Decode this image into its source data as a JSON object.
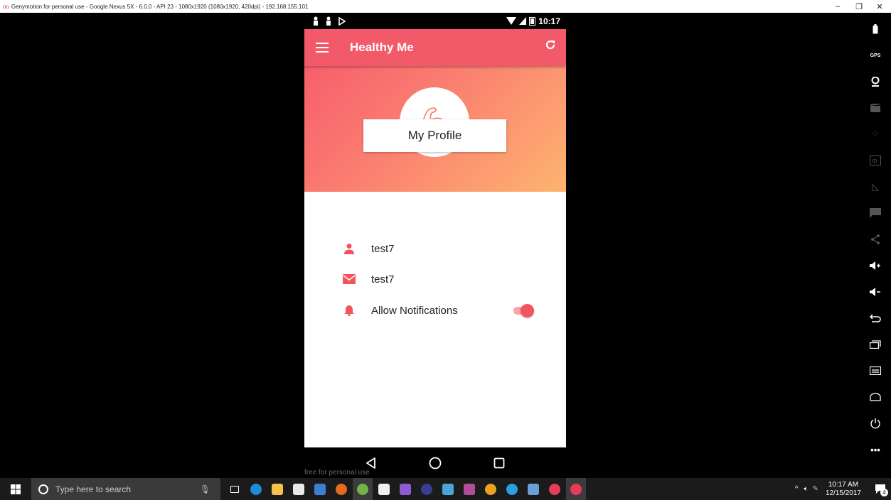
{
  "window": {
    "title": "Genymotion for personal use - Google Nexus 5X - 6.0.0 - API 23 - 1080x1920 (1080x1920, 420dpi) - 192.168.155.101",
    "minimize": "–",
    "restore": "❐",
    "close": "✕"
  },
  "device": {
    "statusbar": {
      "time": "10:17"
    },
    "appbar": {
      "title": "Healthy Me"
    },
    "profile": {
      "card_label": "My Profile"
    },
    "rows": [
      {
        "icon": "person-icon",
        "text": "test7"
      },
      {
        "icon": "mail-icon",
        "text": "test7"
      },
      {
        "icon": "bell-icon",
        "text": "Allow Notifications",
        "toggle_on": true
      }
    ],
    "watermark": "free for personal use"
  },
  "colors": {
    "appbar": "#f25a6a",
    "gradient_start": "#f65e6c",
    "gradient_end": "#fdb46f",
    "accent": "#f2555e"
  },
  "side_toolbar": [
    {
      "name": "battery-icon"
    },
    {
      "name": "gps-icon"
    },
    {
      "name": "webcam-icon"
    },
    {
      "name": "capture-icon"
    },
    {
      "name": "dpad-icon"
    },
    {
      "name": "id-icon"
    },
    {
      "name": "cast-icon"
    },
    {
      "name": "sms-icon"
    },
    {
      "name": "share-icon"
    },
    {
      "name": "volume-up-icon"
    },
    {
      "name": "volume-down-icon"
    },
    {
      "name": "back-icon"
    },
    {
      "name": "recent-apps-icon"
    },
    {
      "name": "menu-icon"
    },
    {
      "name": "home-icon"
    },
    {
      "name": "power-icon"
    },
    {
      "name": "more-icon"
    }
  ],
  "taskbar": {
    "search_placeholder": "Type here to search",
    "time": "10:17 AM",
    "date": "12/15/2017",
    "notification_count": "4"
  }
}
